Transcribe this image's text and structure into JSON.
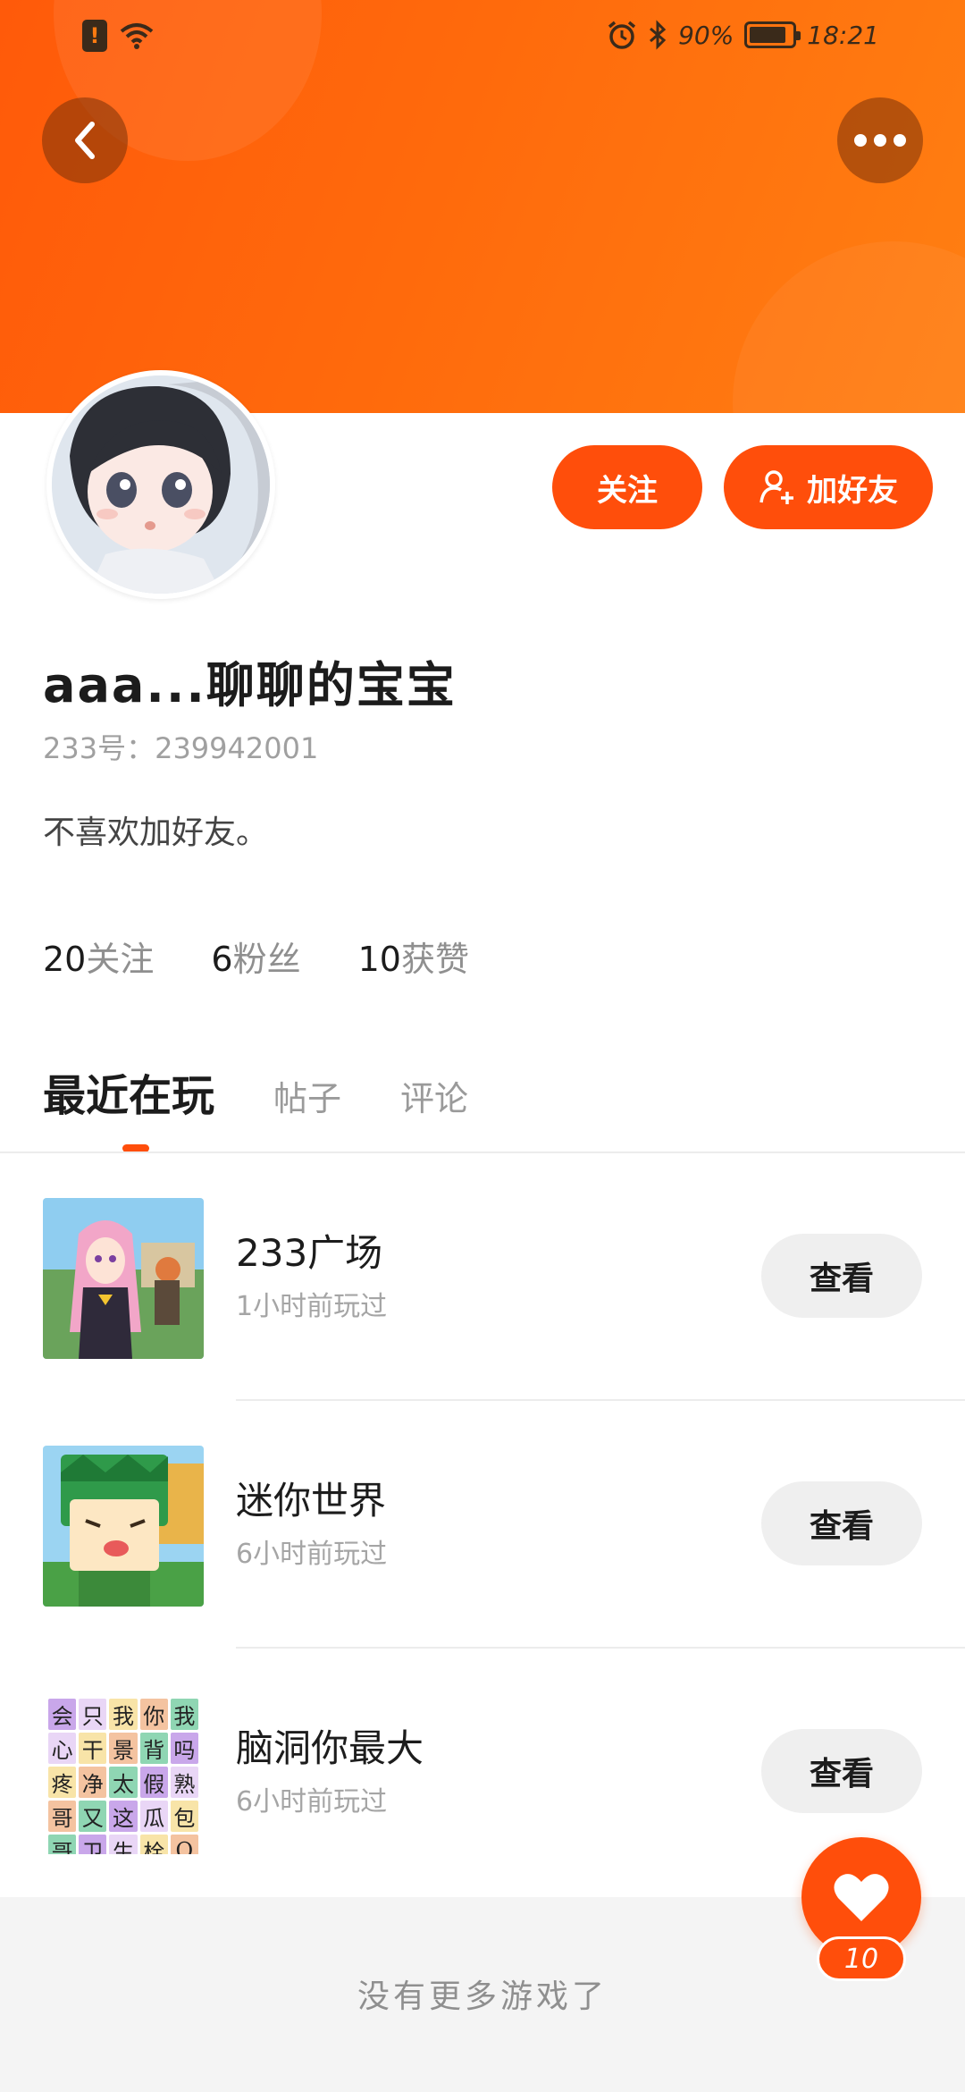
{
  "status_bar": {
    "battery": "90%",
    "time": "18:21"
  },
  "header": {
    "back_icon": "chevron-left-icon",
    "more_icon": "more-dots-icon"
  },
  "profile": {
    "follow_label": "关注",
    "add_friend_label": "加好友",
    "username": "aaa...聊聊的宝宝",
    "user_id": "233号：239942001",
    "bio": "不喜欢加好友。",
    "stats": [
      {
        "num": "20",
        "label": "关注"
      },
      {
        "num": "6",
        "label": "粉丝"
      },
      {
        "num": "10",
        "label": "获赞"
      }
    ]
  },
  "tabs": [
    "最近在玩",
    "帖子",
    "评论"
  ],
  "games": [
    {
      "name": "233广场",
      "time": "1小时前玩过",
      "action": "查看"
    },
    {
      "name": "迷你世界",
      "time": "6小时前玩过",
      "action": "查看"
    },
    {
      "name": "脑洞你最大",
      "time": "6小时前玩过",
      "action": "查看"
    }
  ],
  "puzzle_chars": [
    "会",
    "只",
    "我",
    "你",
    "我",
    "心",
    "干",
    "景",
    "背",
    "吗",
    "疼",
    "净",
    "太",
    "假",
    "熟",
    "哥",
    "又",
    "这",
    "瓜",
    "包",
    "哥",
    "卫",
    "生",
    "栓",
    "Q"
  ],
  "footer_text": "没有更多游戏了",
  "like_count": "10",
  "colors": {
    "accent": "#ff4e0b",
    "header_start": "#ff5a0a",
    "header_end": "#ff7f12"
  }
}
